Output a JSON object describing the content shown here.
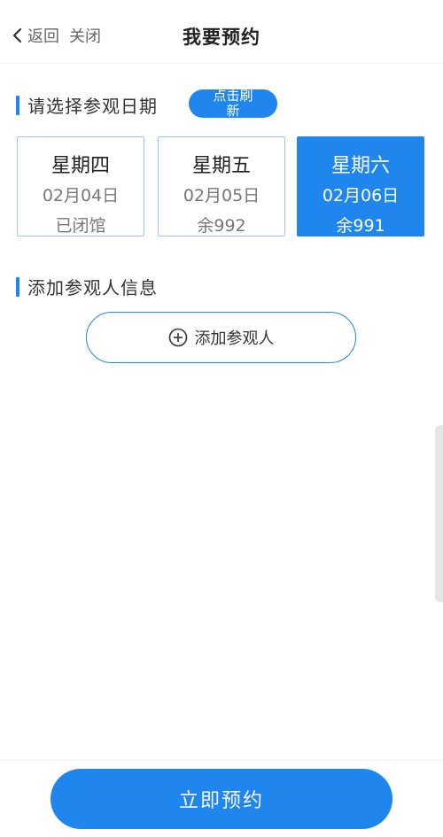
{
  "header": {
    "back_label": "返回",
    "close_label": "关闭",
    "title": "我要预约"
  },
  "date_section": {
    "title": "请选择参观日期",
    "refresh_label": "点击刷新",
    "cards": [
      {
        "weekday": "星期四",
        "date": "02月04日",
        "status": "已闭馆",
        "selected": false
      },
      {
        "weekday": "星期五",
        "date": "02月05日",
        "status": "余992",
        "selected": false
      },
      {
        "weekday": "星期六",
        "date": "02月06日",
        "status": "余991",
        "selected": true
      }
    ]
  },
  "visitor_section": {
    "title": "添加参观人信息",
    "add_label": "添加参观人"
  },
  "footer": {
    "submit_label": "立即预约"
  },
  "colors": {
    "accent": "#1f86ee",
    "card_border": "#9ac7f2"
  },
  "icons": {
    "back": "chevron-left-icon",
    "add": "plus-circle-icon"
  }
}
